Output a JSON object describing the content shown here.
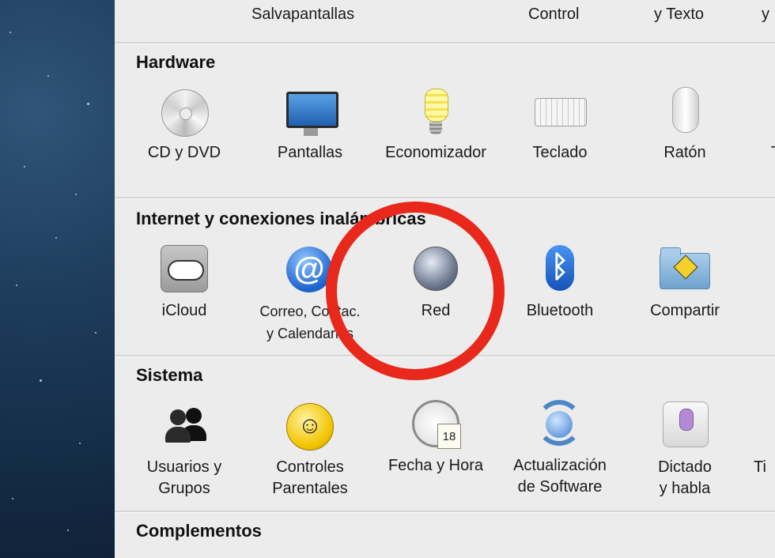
{
  "top_row": {
    "items": [
      {
        "label": "Salvapantallas"
      },
      {
        "label": "Control"
      },
      {
        "label": "y Texto"
      },
      {
        "label": "y"
      }
    ]
  },
  "sections": [
    {
      "title": "Hardware",
      "items": [
        {
          "label": "CD y DVD",
          "icon": "cd-dvd-icon"
        },
        {
          "label": "Pantallas",
          "icon": "displays-icon"
        },
        {
          "label": "Economizador",
          "icon": "energy-saver-icon"
        },
        {
          "label": "Teclado",
          "icon": "keyboard-icon"
        },
        {
          "label": "Ratón",
          "icon": "mouse-icon"
        },
        {
          "label": "T",
          "icon": "trackpad-icon"
        }
      ]
    },
    {
      "title": "Internet y conexiones inalámbricas",
      "items": [
        {
          "label": "iCloud",
          "icon": "icloud-icon"
        },
        {
          "label": "Correo, Contac.\ny Calendarios",
          "icon": "mail-contacts-calendars-icon"
        },
        {
          "label": "Red",
          "icon": "network-icon"
        },
        {
          "label": "Bluetooth",
          "icon": "bluetooth-icon"
        },
        {
          "label": "Compartir",
          "icon": "sharing-icon"
        }
      ]
    },
    {
      "title": "Sistema",
      "items": [
        {
          "label": "Usuarios y\nGrupos",
          "icon": "users-groups-icon"
        },
        {
          "label": "Controles\nParentales",
          "icon": "parental-controls-icon"
        },
        {
          "label": "Fecha y Hora",
          "icon": "date-time-icon",
          "badge": "18"
        },
        {
          "label": "Actualización\nde Software",
          "icon": "software-update-icon"
        },
        {
          "label": "Dictado\ny habla",
          "icon": "dictation-speech-icon"
        },
        {
          "label": "Ti",
          "icon": "time-machine-icon"
        }
      ]
    },
    {
      "title": "Complementos",
      "items": []
    }
  ],
  "annotation": {
    "color": "#e8281a",
    "target": "Correo, Contac. y Calendarios"
  }
}
